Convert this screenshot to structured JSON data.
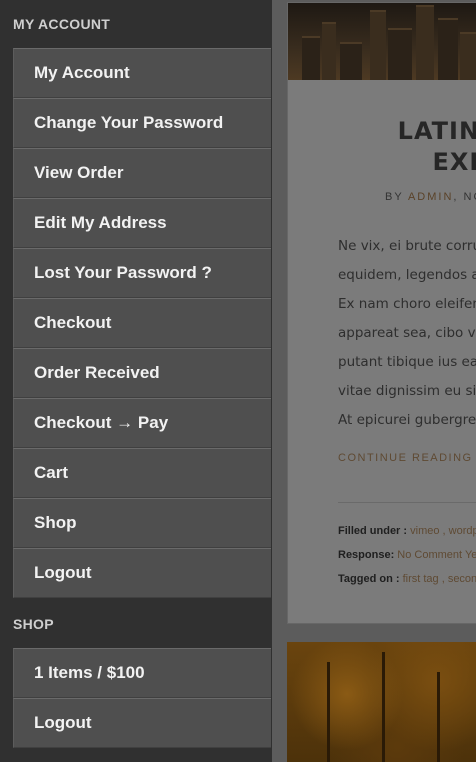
{
  "sidebar": {
    "account_title": "MY ACCOUNT",
    "account_items": [
      "My Account",
      "Change Your Password",
      "View Order",
      "Edit My Address",
      "Lost Your Password ?",
      "Checkout",
      "Order Received",
      "Checkout → Pay",
      "Cart",
      "Shop",
      "Logout"
    ],
    "shop_title": "SHOP",
    "shop_items": [
      "1 Items / $100",
      "Logout"
    ]
  },
  "post": {
    "title_line1": "LATINI",
    "title_line2": "EXP",
    "meta_by": "BY ",
    "meta_author": "ADMIN",
    "meta_rest": ", NO",
    "body_lines": [
      "Ne vix, ei brute corru",
      "equidem, legendos a",
      "Ex nam choro eleifen",
      "appareat sea, cibo vo",
      "putant tibique ius ea,",
      "vitae dignissim eu sit",
      "At epicurei gubergre"
    ],
    "continue": "CONTINUE READING →",
    "filed_label": "Filled under : ",
    "filed_links": "vimeo , wordp",
    "response_label": "Response: ",
    "response_link": "No Comment Ye",
    "tagged_label": "Tagged on : ",
    "tagged_links": "first tag , secon"
  }
}
